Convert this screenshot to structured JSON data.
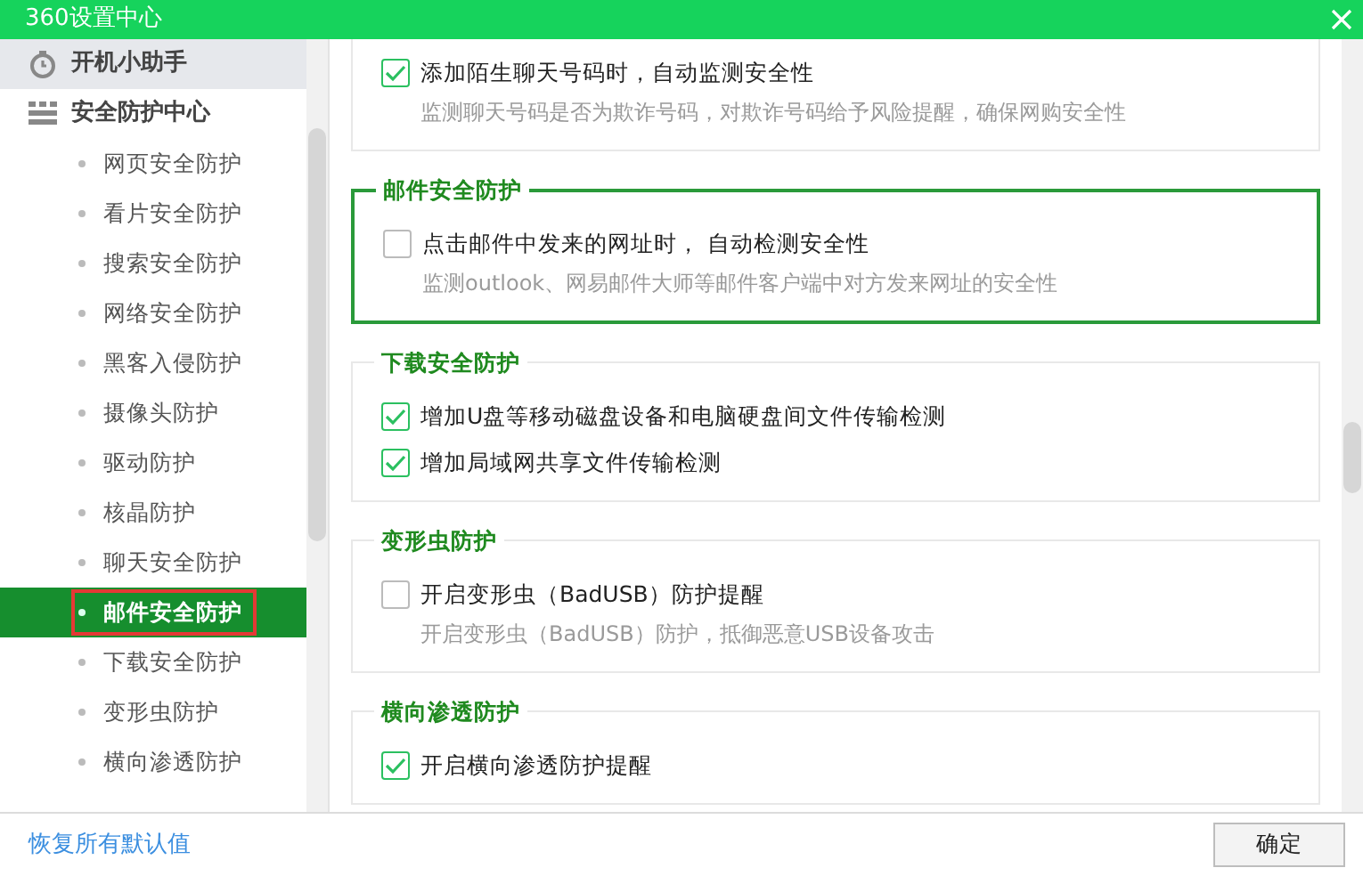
{
  "window": {
    "title": "360设置中心"
  },
  "sidebar": {
    "items": [
      {
        "label": "开机小助手",
        "kind": "shortcut"
      },
      {
        "label": "安全防护中心",
        "kind": "group",
        "children": [
          {
            "label": "网页安全防护",
            "selected": false
          },
          {
            "label": "看片安全防护",
            "selected": false
          },
          {
            "label": "搜索安全防护",
            "selected": false
          },
          {
            "label": "网络安全防护",
            "selected": false
          },
          {
            "label": "黑客入侵防护",
            "selected": false
          },
          {
            "label": "摄像头防护",
            "selected": false
          },
          {
            "label": "驱动防护",
            "selected": false
          },
          {
            "label": "核晶防护",
            "selected": false
          },
          {
            "label": "聊天安全防护",
            "selected": false
          },
          {
            "label": "邮件安全防护",
            "selected": true
          },
          {
            "label": "下载安全防护",
            "selected": false
          },
          {
            "label": "变形虫防护",
            "selected": false
          },
          {
            "label": "横向渗透防护",
            "selected": false
          }
        ]
      }
    ]
  },
  "sections": [
    {
      "highlighted": false,
      "options": [
        {
          "label": "添加陌生聊天号码时，自动监测安全性",
          "checked": true,
          "description": "监测聊天号码是否为欺诈号码，对欺诈号码给予风险提醒，确保网购安全性"
        }
      ]
    },
    {
      "title": "邮件安全防护",
      "highlighted": true,
      "options": [
        {
          "label": "点击邮件中发来的网址时， 自动检测安全性",
          "checked": false,
          "description": "监测outlook、网易邮件大师等邮件客户端中对方发来网址的安全性"
        }
      ]
    },
    {
      "title": "下载安全防护",
      "highlighted": false,
      "options": [
        {
          "label": "增加U盘等移动磁盘设备和电脑硬盘间文件传输检测",
          "checked": true
        },
        {
          "label": "增加局域网共享文件传输检测",
          "checked": true
        }
      ]
    },
    {
      "title": "变形虫防护",
      "highlighted": false,
      "options": [
        {
          "label": "开启变形虫（BadUSB）防护提醒",
          "checked": false,
          "description": "开启变形虫（BadUSB）防护，抵御恶意USB设备攻击"
        }
      ]
    },
    {
      "title": "横向渗透防护",
      "highlighted": false,
      "options": [
        {
          "label": "开启横向渗透防护提醒",
          "checked": true
        }
      ]
    }
  ],
  "footer": {
    "reset_link": "恢复所有默认值",
    "ok_button": "确定"
  }
}
